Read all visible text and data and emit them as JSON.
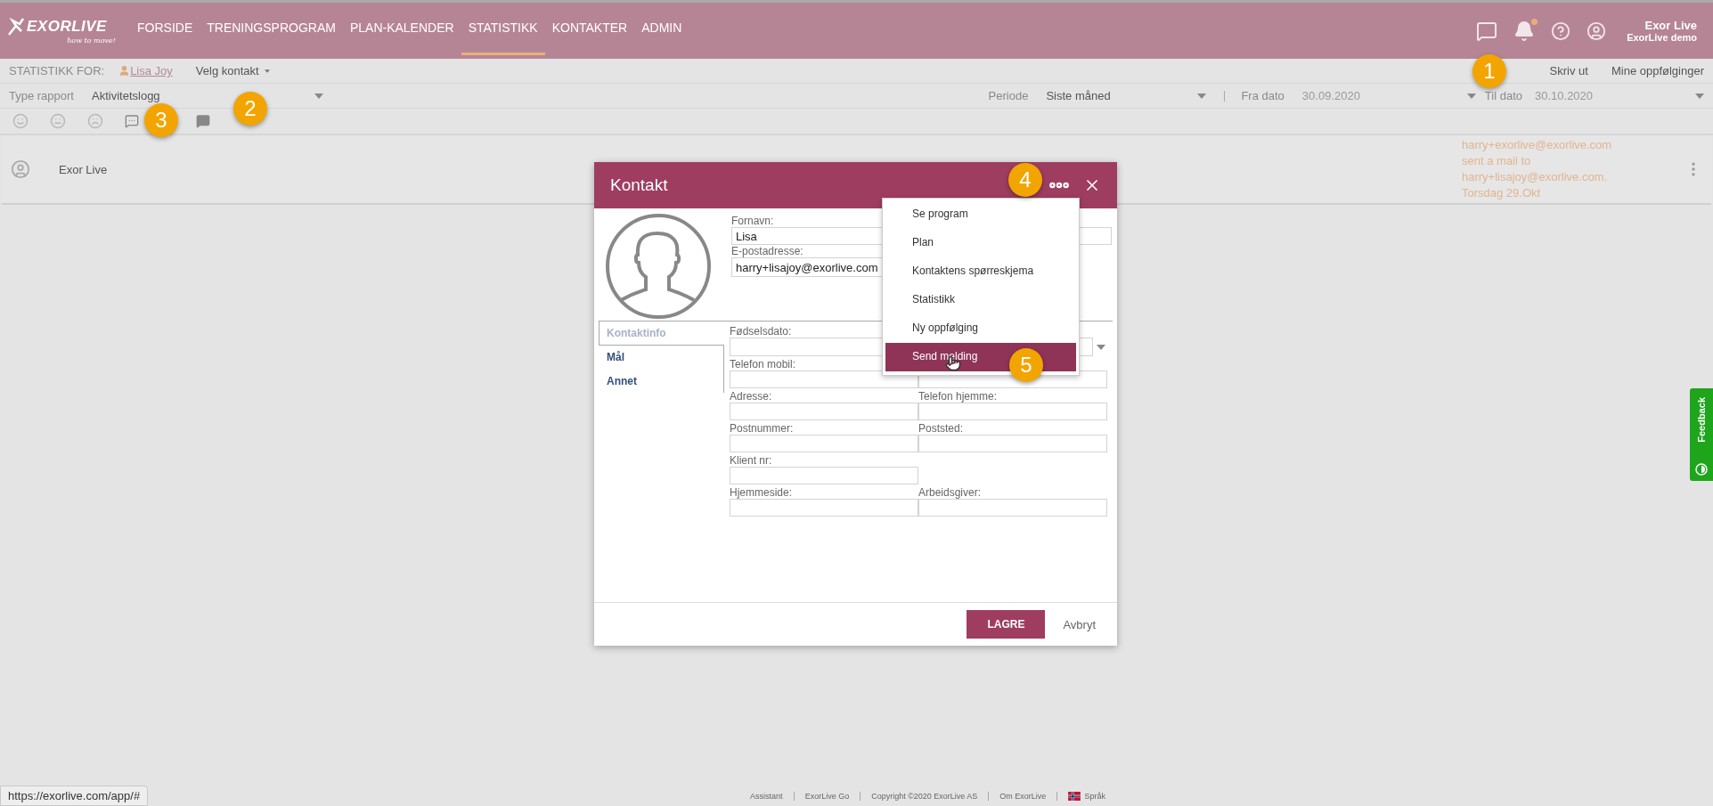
{
  "header": {
    "logo": {
      "name": "EXORLIVE",
      "tagline": "how to move!"
    },
    "nav": [
      {
        "label": "FORSIDE",
        "selected": false
      },
      {
        "label": "TRENINGSPROGRAM",
        "selected": false
      },
      {
        "label": "PLAN-KALENDER",
        "selected": false
      },
      {
        "label": "STATISTIKK",
        "selected": true
      },
      {
        "label": "KONTAKTER",
        "selected": false
      },
      {
        "label": "ADMIN",
        "selected": false
      }
    ],
    "notifications_unread": true,
    "user": {
      "name": "Exor Live",
      "account": "ExorLive demo"
    }
  },
  "context_bar": {
    "label": "STATISTIKK FOR:",
    "contact": "Lisa Joy",
    "picker": "Velg kontakt",
    "actions": [
      "Skriv ut",
      "Mine oppfølginger"
    ]
  },
  "filters": {
    "report_label": "Type rapport",
    "report": "Aktivitetslogg",
    "period_label": "Periode",
    "period": "Siste måned",
    "from_label": "Fra dato",
    "from": "30.09.2020",
    "to_label": "Til dato",
    "to": "30.10.2020"
  },
  "activity": [
    {
      "name": "Exor Live",
      "lines": [
        "harry+exorlive@exorlive.com",
        "sent a mail to",
        "harry+lisajoy@exorlive.com.",
        "Torsdag 29.Okt"
      ]
    }
  ],
  "dialog": {
    "title": "Kontakt",
    "top_fields": [
      {
        "label": "Fornavn:",
        "value": "Lisa",
        "kind": "wide"
      },
      {
        "label": "E-postadresse:",
        "value": "harry+lisajoy@exorlive.com",
        "kind": "half"
      }
    ],
    "tabs": [
      {
        "label": "Kontaktinfo",
        "selected": true
      },
      {
        "label": "Mål",
        "selected": false
      },
      {
        "label": "Annet",
        "selected": false
      }
    ],
    "rows": [
      [
        {
          "label": "Fødselsdato:",
          "kind": "date"
        }
      ],
      [
        {
          "label": "Telefon mobil:",
          "kind": "text"
        },
        {
          "kind": "text"
        }
      ],
      [
        {
          "label": "Adresse:",
          "kind": "text"
        },
        {
          "label": "Telefon hjemme:",
          "kind": "text"
        }
      ],
      [
        {
          "label": "Postnummer:",
          "kind": "text"
        },
        {
          "label": "Poststed:",
          "kind": "text"
        }
      ],
      [
        {
          "label": "Klient nr:",
          "kind": "text"
        }
      ],
      [
        {
          "label": "Hjemmeside:",
          "kind": "text"
        },
        {
          "label": "Arbeidsgiver:",
          "kind": "text"
        }
      ]
    ],
    "menu": [
      {
        "label": "Se program",
        "selected": false
      },
      {
        "label": "Plan",
        "selected": false
      },
      {
        "label": "Kontaktens spørreskjema",
        "selected": false
      },
      {
        "label": "Statistikk",
        "selected": false
      },
      {
        "label": "Ny oppfølging",
        "selected": false
      },
      {
        "label": "Send melding",
        "selected": true
      }
    ],
    "save": "LAGRE",
    "cancel": "Avbryt"
  },
  "callouts": [
    "1",
    "2",
    "3",
    "4",
    "5"
  ],
  "feedback": "Feedback",
  "footer": [
    "Assistant",
    "ExorLive Go",
    "Copyright ©2020 ExorLive AS",
    "Om ExorLive",
    "Språk"
  ],
  "status_url": "https://exorlive.com/app/#"
}
